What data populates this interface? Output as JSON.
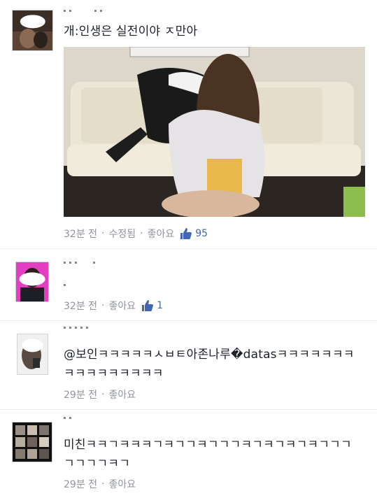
{
  "comments": [
    {
      "text": "개:인생은 실전이야 ㅈ만아",
      "time": "32분 전",
      "edited": "수정됨",
      "like_label": "좋아요",
      "likes": "95"
    },
    {
      "text": "",
      "time": "32분 전",
      "like_label": "좋아요",
      "likes": "1"
    },
    {
      "text": "@보인ㅋㅋㅋㅋㅋㅅㅂㅌ아존나루�datasㅋㅋㅋㅋㅋㅋㅋㅋㅋㅋㅋㅋㅋㅋㅋㅋ",
      "time": "29분 전",
      "like_label": "좋아요"
    },
    {
      "text": "미친ㅋㅋㄱㅋㅋㅋㄱㅋㄱㄱㅋㄱㄱㄱㅋㄱㅋㄱㅋㄱㅋㄱㄱㄱㄱㄱㄱㄱㅋㄱ",
      "time": "29분 전",
      "like_label": "좋아요"
    }
  ],
  "separator": "·",
  "icons": {
    "like": "thumbs-up-icon"
  },
  "colors": {
    "like_accent": "#4267b2",
    "meta_text": "#90949c"
  }
}
